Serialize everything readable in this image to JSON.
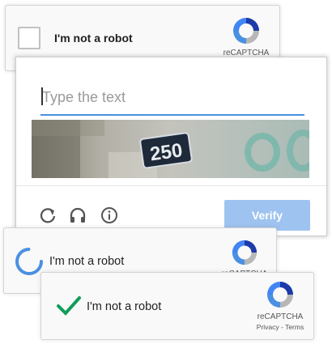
{
  "widget_top": {
    "label": "I'm not a robot",
    "logo_text": "reCAPTCHA"
  },
  "challenge": {
    "input_placeholder": "Type the text",
    "image_text": "250",
    "verify_label": "Verify",
    "icons": [
      "reload-icon",
      "audio-icon",
      "info-icon"
    ]
  },
  "widget_loading": {
    "label": "I'm not a robot",
    "logo_text": "reCAPTCHA"
  },
  "widget_verified": {
    "label": "I'm not a robot",
    "logo_text": "reCAPTCHA",
    "links": "Privacy - Terms"
  },
  "colors": {
    "accent": "#4a90e2",
    "verify_button": "#9fc3f0",
    "check": "#109d58",
    "spinner": "#4a90e2"
  }
}
